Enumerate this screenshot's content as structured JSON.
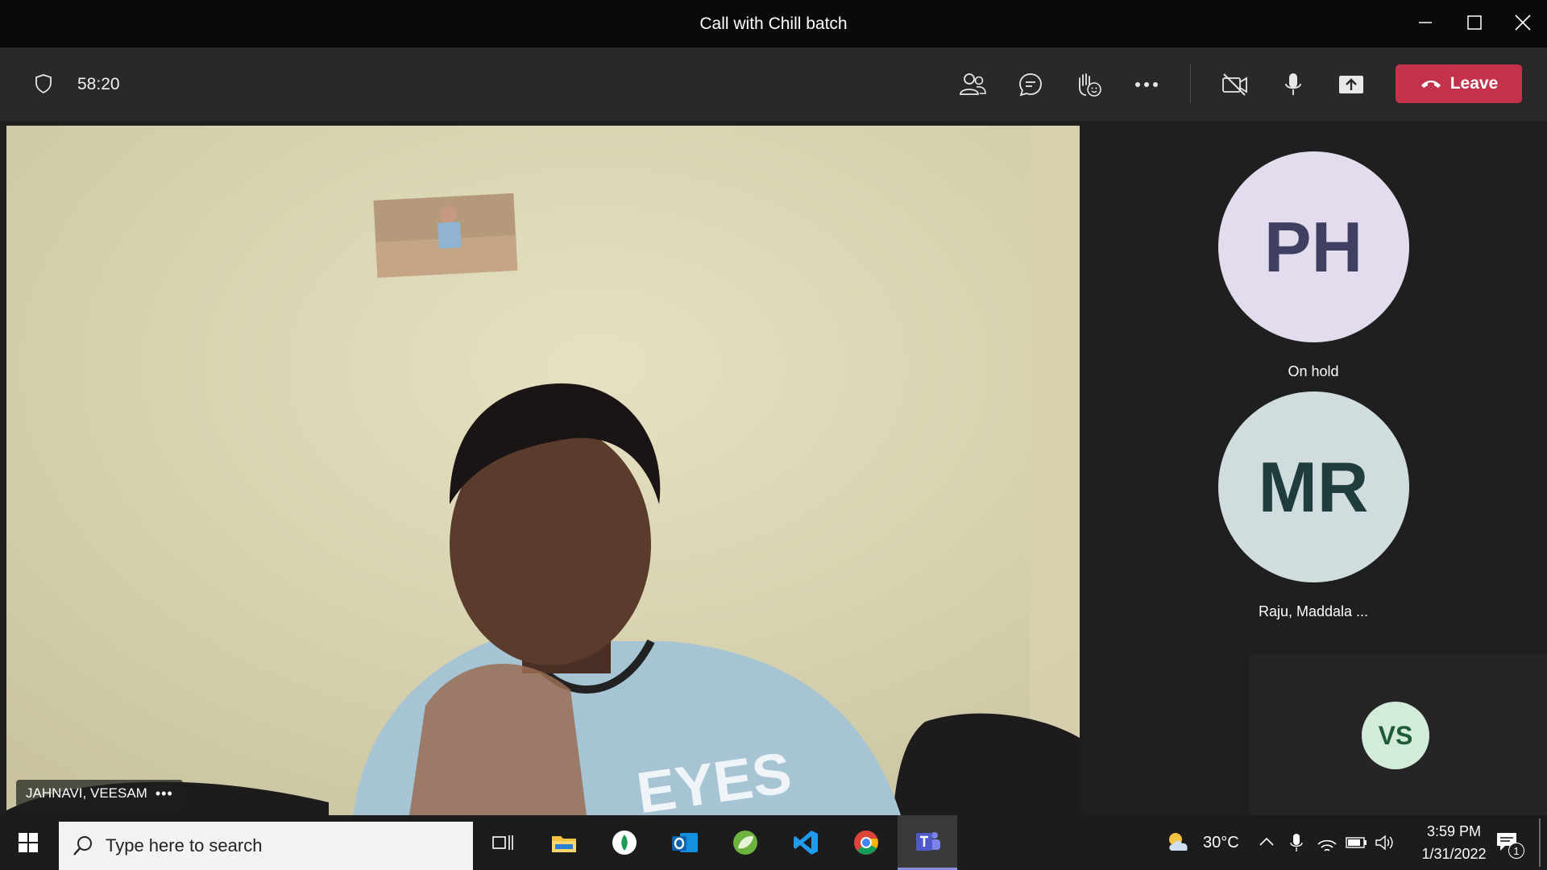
{
  "window": {
    "title": "Call with Chill batch"
  },
  "toolbar": {
    "timer": "58:20",
    "leave_label": "Leave"
  },
  "main_video": {
    "participant_name": "JAHNAVI, VEESAM"
  },
  "participants": [
    {
      "initials": "PH",
      "label": "On hold",
      "bg": "#e2dcee",
      "fg": "#3e3f61"
    },
    {
      "initials": "MR",
      "label": "Raju, Maddala ...",
      "bg": "#d1dcdf",
      "fg": "#1f3d3c"
    },
    {
      "initials": "VS",
      "bg": "#d3ebdb",
      "fg": "#1f5a37"
    }
  ],
  "taskbar": {
    "search_placeholder": "Type here to search",
    "weather_temp": "30°C",
    "time": "3:59 PM",
    "date": "1/31/2022",
    "notification_count": "1"
  },
  "colors": {
    "leave": "#c4314b",
    "titlebar": "#0a0a0a",
    "toolbar": "#292929"
  }
}
